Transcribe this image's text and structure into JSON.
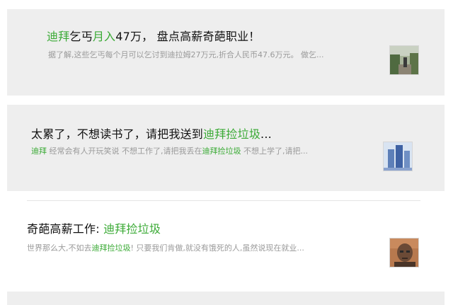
{
  "articles": [
    {
      "title_parts": [
        "迪拜",
        "乞丐",
        "月入",
        "47万，  盘点高薪奇葩职业！"
      ],
      "snippet": "据了解,这些乞丐每个月可以乞讨到迪拉姆27万元,折合人民币47.6万元。 做乞...",
      "thumb_icon": "outdoor-photo-icon"
    },
    {
      "title_parts": [
        "太累了，不想读书了，请把我送到",
        "迪拜捡垃圾",
        "..."
      ],
      "snippet_parts": [
        "迪拜",
        " 经常会有人开玩笑说 不想工作了,请把我丢在",
        "迪拜捡垃圾",
        " 不想上学了,请把..."
      ],
      "thumb_icon": "skyscraper-photo-icon"
    },
    {
      "title_parts": [
        "奇葩高薪工作: ",
        "迪拜捡垃圾"
      ],
      "snippet_parts": [
        "世界那么大,不如去",
        "迪拜捡垃圾",
        "! 只要我们肯做,就没有饿死的人,虽然说现在就业..."
      ],
      "thumb_icon": "man-portrait-photo-icon"
    }
  ],
  "colors": {
    "highlight": "#3aaa35",
    "title": "#111111",
    "snippet": "#9a9a9a",
    "card_bg": "#eeeeee"
  }
}
